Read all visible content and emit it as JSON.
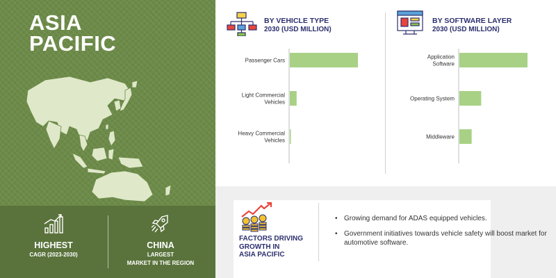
{
  "region": {
    "title_line1": "ASIA",
    "title_line2": "PACIFIC"
  },
  "stats": [
    {
      "headline": "HIGHEST",
      "detail_line1": "CAGR (2023-2030)",
      "detail_line2": "",
      "icon": "growth-bars-icon"
    },
    {
      "headline": "CHINA",
      "detail_line1": "LARGEST",
      "detail_line2": "MARKET IN THE REGION",
      "icon": "rocket-icon"
    }
  ],
  "colors": {
    "panel_green": "#6c8a48",
    "panel_green_dark": "#5a733c",
    "bar": "#a8d185",
    "heading": "#2c2f6e",
    "bottom_bg": "#efefef"
  },
  "vehicle_panel": {
    "title": "BY VEHICLE TYPE",
    "subtitle": "2030 (USD MILLION)",
    "icon": "flowchart-icon"
  },
  "software_panel": {
    "title": "BY SOFTWARE LAYER",
    "subtitle": "2030 (USD MILLION)",
    "icon": "software-window-icon"
  },
  "chart_data": [
    {
      "type": "bar",
      "orientation": "horizontal",
      "title": "BY VEHICLE TYPE",
      "subtitle": "2030 (USD MILLION)",
      "categories": [
        [
          "Passenger Cars"
        ],
        [
          "Light Commercial",
          "Vehicles"
        ],
        [
          "Heavy Commercial",
          "Vehicles"
        ]
      ],
      "values": [
        100,
        10,
        1.5
      ],
      "xlim": [
        0,
        100
      ],
      "grid": false,
      "legend": "none"
    },
    {
      "type": "bar",
      "orientation": "horizontal",
      "title": "BY SOFTWARE LAYER",
      "subtitle": "2030 (USD MILLION)",
      "categories": [
        [
          "Application",
          "Software"
        ],
        [
          "Operating System"
        ],
        [
          "Middleware"
        ]
      ],
      "values": [
        100,
        32,
        18
      ],
      "xlim": [
        0,
        100
      ],
      "grid": false,
      "legend": "none"
    }
  ],
  "factors": {
    "label_lines": [
      "FACTORS DRIVING",
      "GROWTH IN",
      "ASIA PACIFIC"
    ],
    "icon": "coins-growth-icon",
    "bullets": [
      "Growing demand for ADAS equipped vehicles.",
      "Government initiatives towards vehicle safety will boost market for automotive software."
    ]
  }
}
